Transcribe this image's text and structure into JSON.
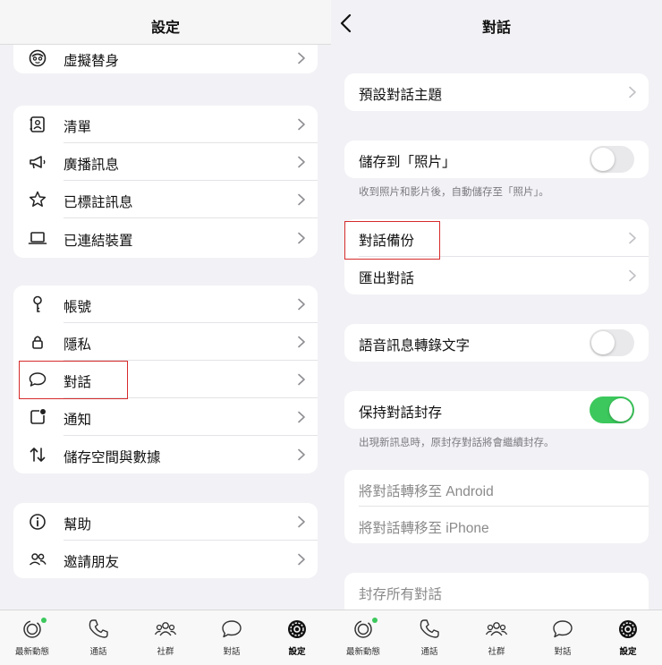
{
  "left": {
    "title": "設定",
    "sections": [
      {
        "items": [
          {
            "label": "虛擬替身",
            "icon": "avatar-icon"
          }
        ]
      },
      {
        "items": [
          {
            "label": "清單",
            "icon": "list-icon"
          },
          {
            "label": "廣播訊息",
            "icon": "megaphone-icon"
          },
          {
            "label": "已標註訊息",
            "icon": "star-icon"
          },
          {
            "label": "已連結裝置",
            "icon": "laptop-icon"
          }
        ]
      },
      {
        "items": [
          {
            "label": "帳號",
            "icon": "key-icon"
          },
          {
            "label": "隱私",
            "icon": "lock-icon"
          },
          {
            "label": "對話",
            "icon": "chat-bubble-icon"
          },
          {
            "label": "通知",
            "icon": "notification-icon"
          },
          {
            "label": "儲存空間與數據",
            "icon": "up-down-arrows-icon"
          }
        ]
      },
      {
        "items": [
          {
            "label": "幫助",
            "icon": "info-icon"
          },
          {
            "label": "邀請朋友",
            "icon": "people-icon"
          }
        ]
      }
    ]
  },
  "right": {
    "title": "對話",
    "items": {
      "default_theme": "預設對話主題",
      "save_to_photos": "儲存到「照片」",
      "save_to_photos_note": "收到照片和影片後，自動儲存至「照片」。",
      "chat_backup": "對話備份",
      "export_chat": "匯出對話",
      "voice_transcription": "語音訊息轉錄文字",
      "keep_archived": "保持對話封存",
      "keep_archived_note": "出現新訊息時，原封存對話將會繼續封存。",
      "move_android": "將對話轉移至 Android",
      "move_iphone": "將對話轉移至 iPhone",
      "archive_all": "封存所有對話"
    },
    "toggles": {
      "save_to_photos": false,
      "voice_transcription": false,
      "keep_archived": true
    }
  },
  "tabbar": {
    "tabs": [
      {
        "label": "最新動態",
        "icon": "updates-icon"
      },
      {
        "label": "通話",
        "icon": "phone-icon"
      },
      {
        "label": "社群",
        "icon": "communities-icon"
      },
      {
        "label": "對話",
        "icon": "chats-icon"
      },
      {
        "label": "設定",
        "icon": "settings-gear-icon",
        "active": true
      }
    ]
  },
  "colors": {
    "accent_green": "#3cc85c",
    "highlight_red": "#d62b2b",
    "background": "#f2f2f6"
  }
}
